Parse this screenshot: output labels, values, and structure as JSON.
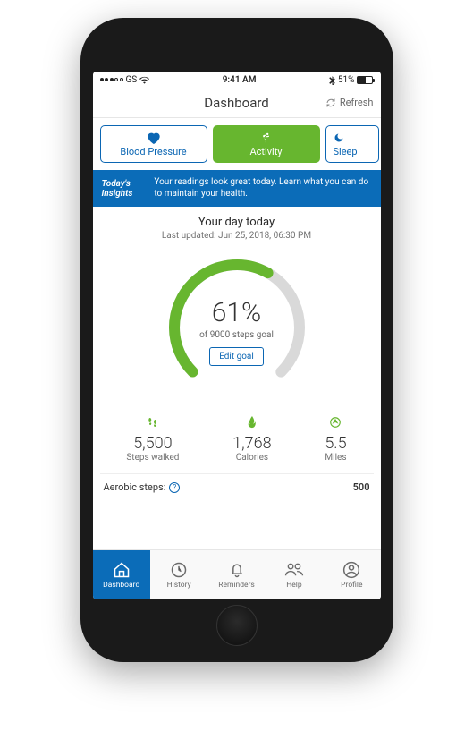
{
  "status": {
    "carrier": "GS",
    "time": "9:41 AM",
    "battery_pct": "51%"
  },
  "header": {
    "title": "Dashboard",
    "refresh_label": "Refresh"
  },
  "tabs": {
    "blood_pressure": "Blood Pressure",
    "activity": "Activity",
    "sleep": "Sleep"
  },
  "insights": {
    "label": "Today's Insights",
    "text": "Your readings look great today. Learn what you can do to maintain your health."
  },
  "summary": {
    "title": "Your day today",
    "updated": "Last updated: Jun 25, 2018, 06:30 PM"
  },
  "gauge": {
    "percent_display": "61%",
    "percent_value": 61,
    "goal_text": "of 9000 steps goal",
    "edit_label": "Edit goal"
  },
  "metrics": {
    "steps_value": "5,500",
    "steps_label": "Steps walked",
    "calories_value": "1,768",
    "calories_label": "Calories",
    "miles_value": "5.5",
    "miles_label": "Miles"
  },
  "aerobic": {
    "label": "Aerobic steps:",
    "value": "500"
  },
  "nav": {
    "dashboard": "Dashboard",
    "history": "History",
    "reminders": "Reminders",
    "help": "Help",
    "profile": "Profile"
  },
  "colors": {
    "primary_blue": "#0b6cb8",
    "accent_green": "#67b62f"
  }
}
